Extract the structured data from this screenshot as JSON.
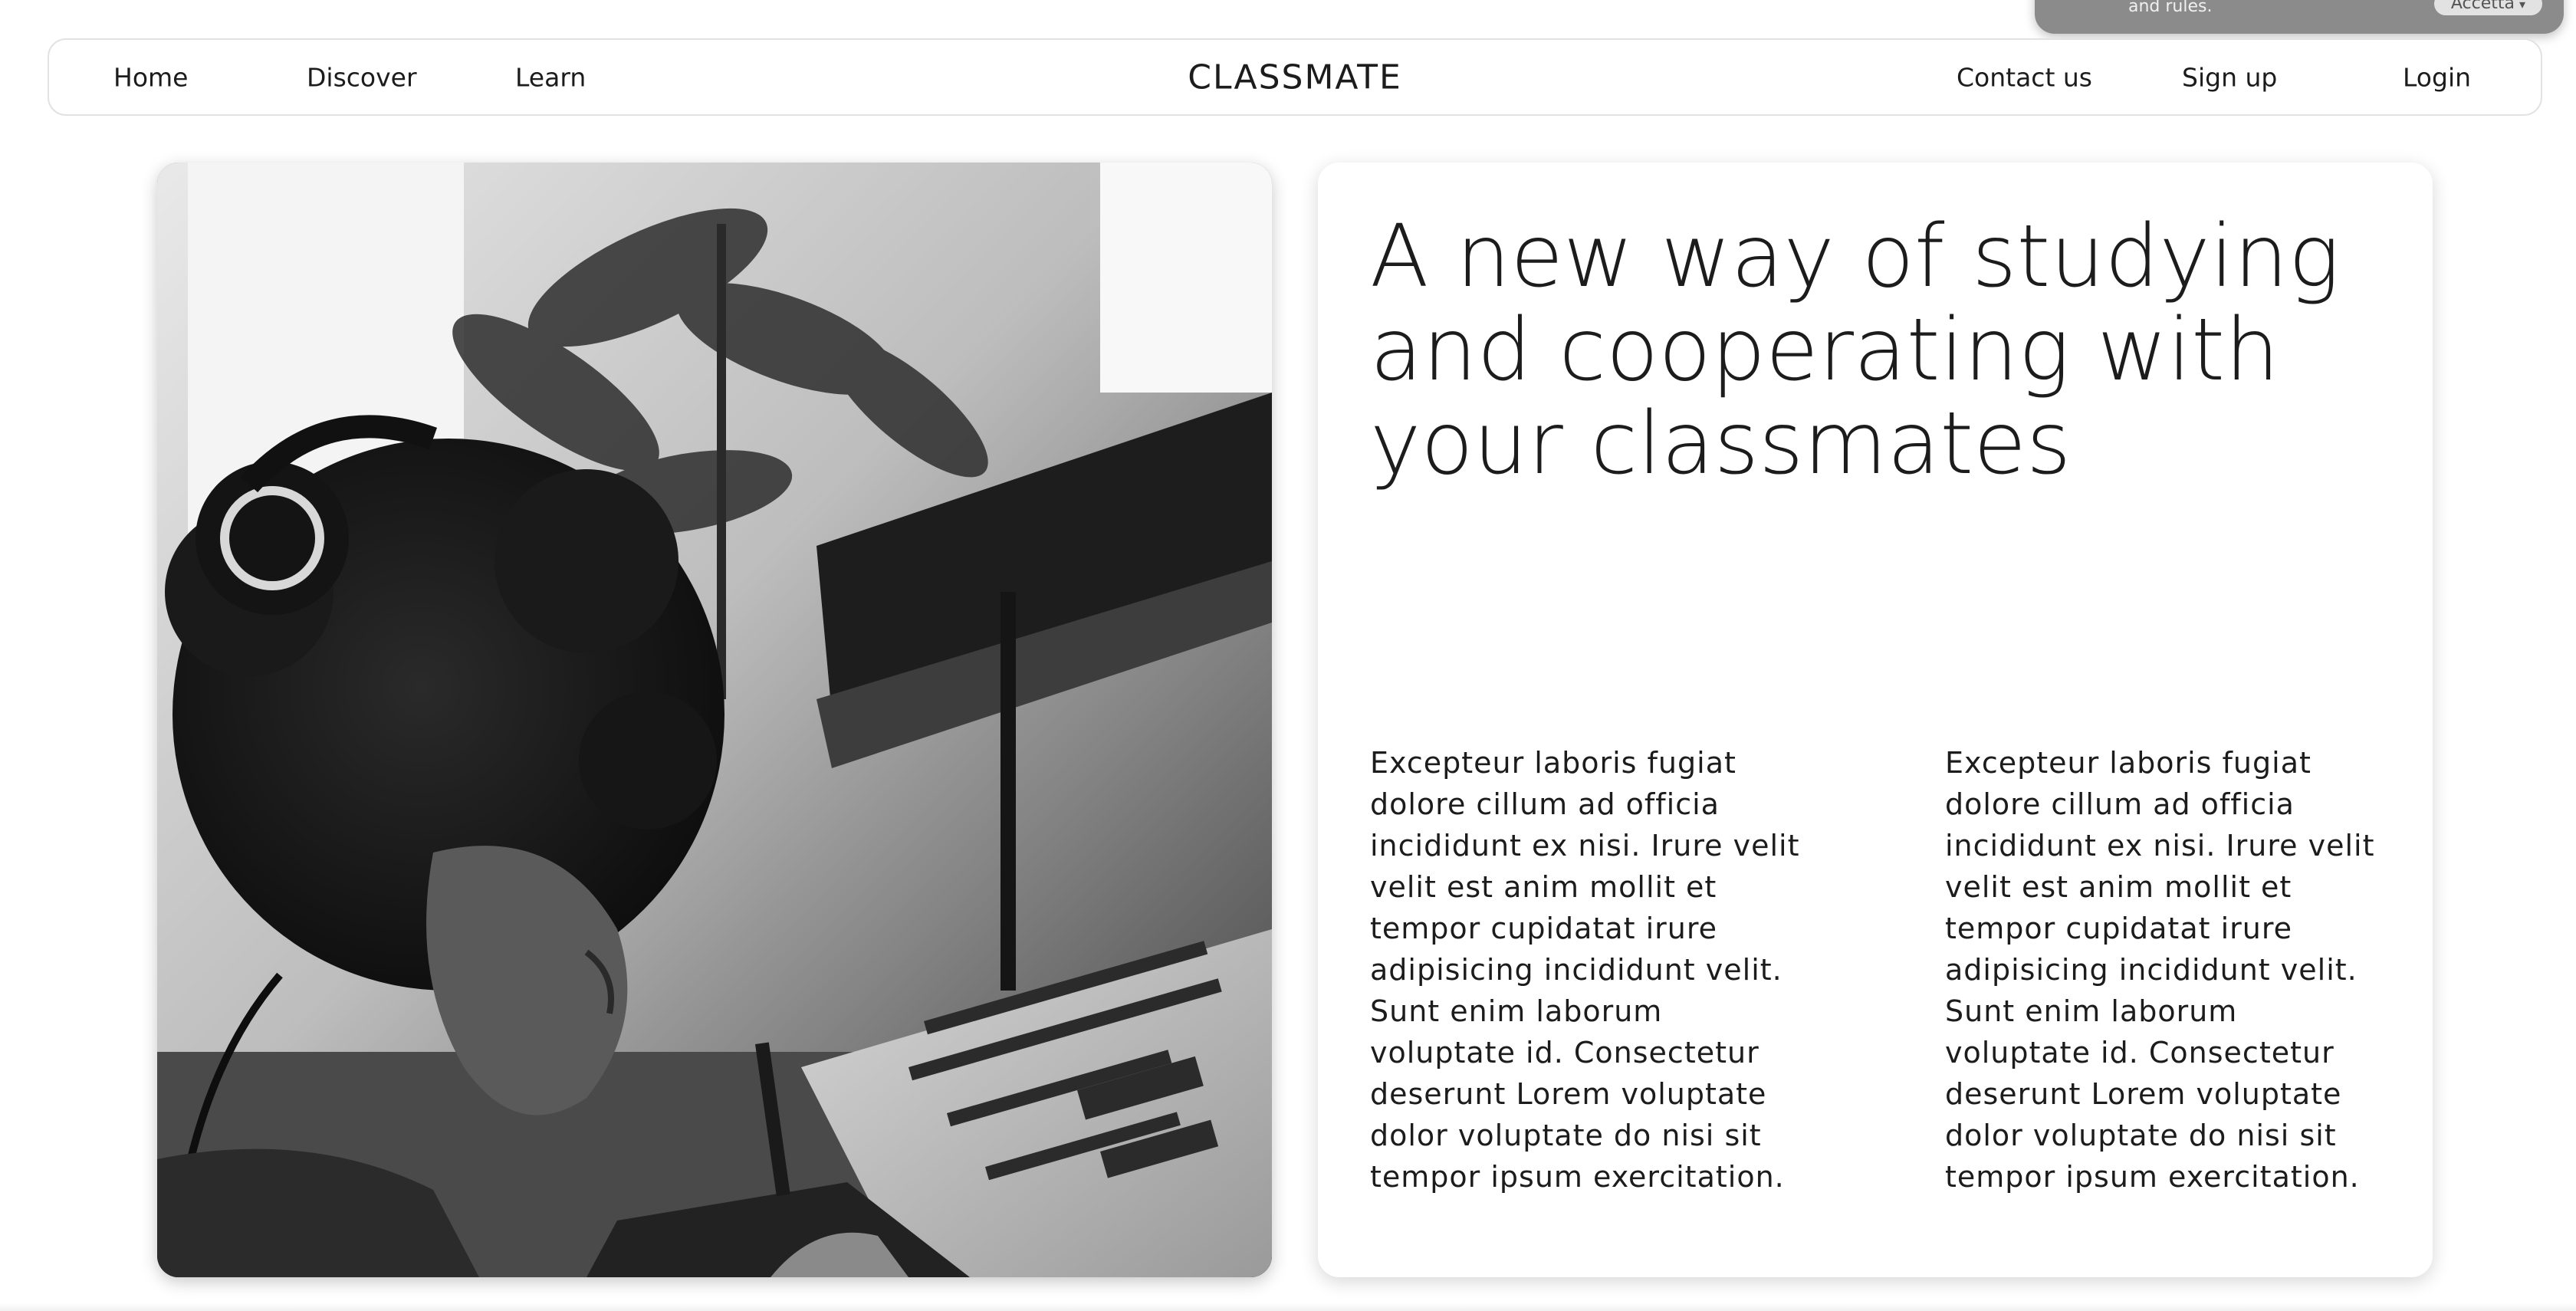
{
  "cookie_popup": {
    "text": "and rules.",
    "accept_label": "Accetta",
    "accept_icon": "chevron-down-icon"
  },
  "nav": {
    "home": "Home",
    "discover": "Discover",
    "learn": "Learn",
    "brand": "CLASSMATE",
    "contact": "Contact us",
    "signup": "Sign up",
    "login": "Login"
  },
  "hero": {
    "image_alt": "Student with headphones writing in a notebook in front of a laptop",
    "headline": "A new way of studying and cooperating with your classmates",
    "paragraphs": [
      "Excepteur laboris fugiat dolore cillum ad officia incididunt ex nisi. Irure velit velit est anim mollit et tempor cupidatat irure adipisicing incididunt velit. Sunt enim laborum voluptate id. Consectetur deserunt Lorem voluptate dolor voluptate do nisi sit tempor ipsum exercitation.",
      "Excepteur laboris fugiat dolore cillum ad officia incididunt ex nisi. Irure velit velit est anim mollit et tempor cupidatat irure adipisicing incididunt velit. Sunt enim laborum voluptate id. Consectetur deserunt Lorem voluptate dolor voluptate do nisi sit tempor ipsum exercitation."
    ]
  },
  "colors": {
    "text": "#1c1c1c",
    "nav_border": "#e2e2e2",
    "popup_bg": "#8b8b8b"
  }
}
